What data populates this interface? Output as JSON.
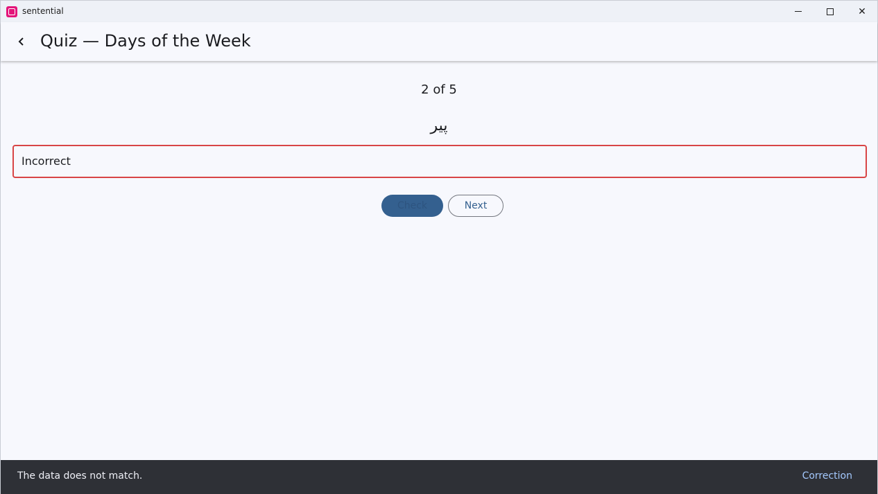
{
  "window": {
    "app_name": "sentential",
    "minimize_icon": "minimize-icon",
    "maximize_icon": "maximize-icon",
    "close_icon": "close-icon",
    "close_glyph": "✕"
  },
  "appbar": {
    "back_icon": "chevron-left-icon",
    "title": "Quiz — Days of the Week"
  },
  "quiz": {
    "progress": "2 of 5",
    "word": "پیر",
    "answer_value": "Incorrect",
    "check_label": "Check",
    "next_label": "Next"
  },
  "snackbar": {
    "message": "The data does not match.",
    "action": "Correction"
  },
  "colors": {
    "accent": "#34608f",
    "error": "#d84545",
    "snackbar_bg": "#2e3036",
    "snackbar_action": "#a4c9fe",
    "brand": "#e3157a"
  }
}
